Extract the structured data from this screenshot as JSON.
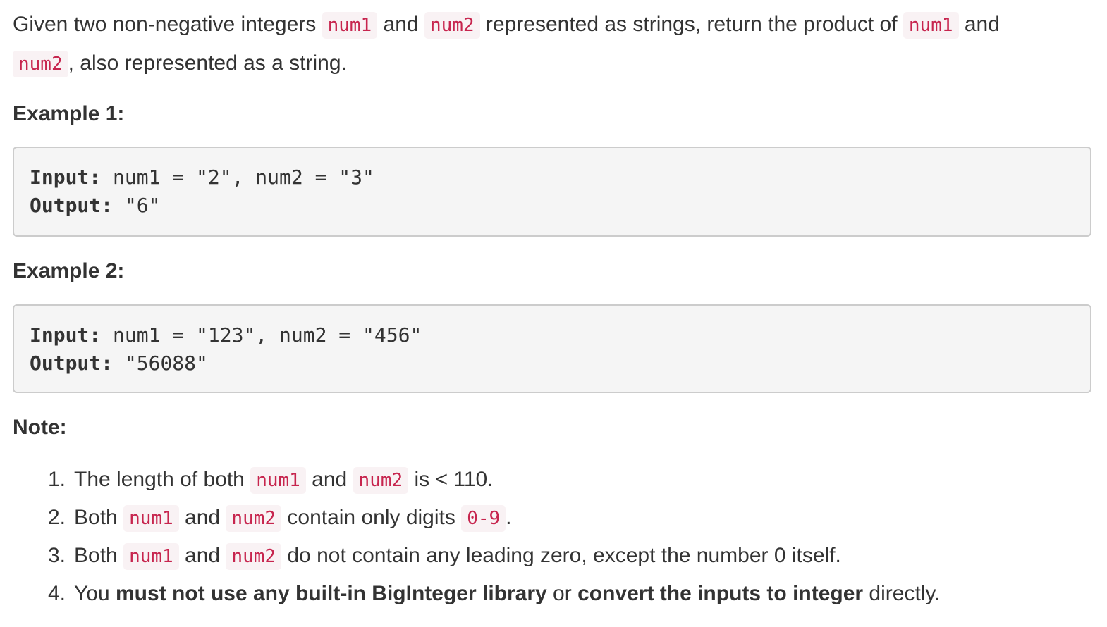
{
  "intro": {
    "t1": "Given two non-negative integers ",
    "c1": "num1",
    "t2": " and ",
    "c2": "num2",
    "t3": " represented as strings, return the product of ",
    "c3": "num1",
    "t4": " and ",
    "c4": "num2",
    "t5": ", also represented as a string."
  },
  "example1": {
    "heading": "Example 1:",
    "input_label": "Input:",
    "input_value": " num1 = \"2\", num2 = \"3\"",
    "output_label": "Output:",
    "output_value": " \"6\""
  },
  "example2": {
    "heading": "Example 2:",
    "input_label": "Input:",
    "input_value": " num1 = \"123\", num2 = \"456\"",
    "output_label": "Output:",
    "output_value": " \"56088\""
  },
  "note": {
    "heading": "Note:",
    "items": [
      {
        "num": "1.",
        "a": "The length of both ",
        "c1": "num1",
        "b": " and ",
        "c2": "num2",
        "c": " is < 110."
      },
      {
        "num": "2.",
        "a": "Both ",
        "c1": "num1",
        "b": " and ",
        "c2": "num2",
        "c": " contain only digits ",
        "c3": "0-9",
        "d": "."
      },
      {
        "num": "3.",
        "a": "Both ",
        "c1": "num1",
        "b": " and ",
        "c2": "num2",
        "c": " do not contain any leading zero, except the number 0 itself."
      },
      {
        "num": "4.",
        "a": "You ",
        "bold1": "must not use any built-in BigInteger library",
        "b": " or ",
        "bold2": "convert the inputs to integer",
        "c": " directly."
      }
    ]
  }
}
